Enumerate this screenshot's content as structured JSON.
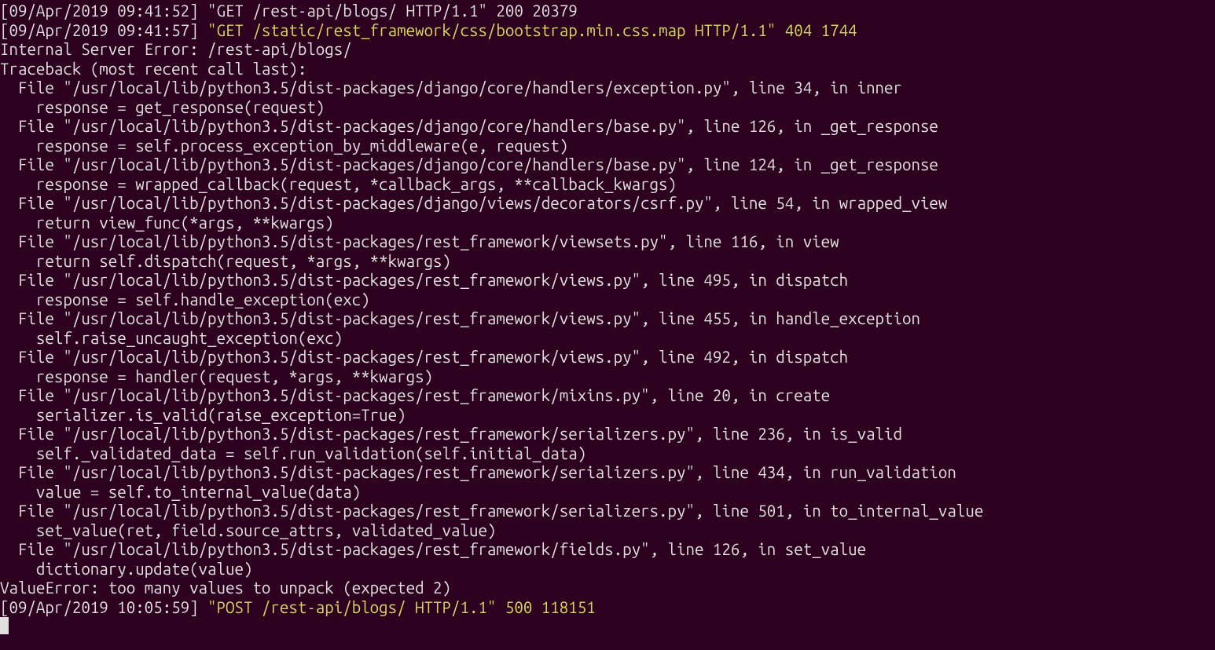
{
  "terminal": {
    "lines": [
      {
        "segments": [
          {
            "cls": "grey",
            "text": "[09/Apr/2019 09:41:52] "
          },
          {
            "cls": "grey",
            "text": "\"GET /rest-api/blogs/ HTTP/1.1\" 200 20379"
          }
        ]
      },
      {
        "segments": [
          {
            "cls": "grey",
            "text": "[09/Apr/2019 09:41:57] "
          },
          {
            "cls": "yellow",
            "text": "\"GET /static/rest_framework/css/bootstrap.min.css.map HTTP/1.1\" 404 1744"
          }
        ]
      },
      {
        "segments": [
          {
            "cls": "grey",
            "text": "Internal Server Error: /rest-api/blogs/"
          }
        ]
      },
      {
        "segments": [
          {
            "cls": "grey",
            "text": "Traceback (most recent call last):"
          }
        ]
      },
      {
        "segments": [
          {
            "cls": "grey",
            "text": "  File \"/usr/local/lib/python3.5/dist-packages/django/core/handlers/exception.py\", line 34, in inner"
          }
        ]
      },
      {
        "segments": [
          {
            "cls": "grey",
            "text": "    response = get_response(request)"
          }
        ]
      },
      {
        "segments": [
          {
            "cls": "grey",
            "text": "  File \"/usr/local/lib/python3.5/dist-packages/django/core/handlers/base.py\", line 126, in _get_response"
          }
        ]
      },
      {
        "segments": [
          {
            "cls": "grey",
            "text": "    response = self.process_exception_by_middleware(e, request)"
          }
        ]
      },
      {
        "segments": [
          {
            "cls": "grey",
            "text": "  File \"/usr/local/lib/python3.5/dist-packages/django/core/handlers/base.py\", line 124, in _get_response"
          }
        ]
      },
      {
        "segments": [
          {
            "cls": "grey",
            "text": "    response = wrapped_callback(request, *callback_args, **callback_kwargs)"
          }
        ]
      },
      {
        "segments": [
          {
            "cls": "grey",
            "text": "  File \"/usr/local/lib/python3.5/dist-packages/django/views/decorators/csrf.py\", line 54, in wrapped_view"
          }
        ]
      },
      {
        "segments": [
          {
            "cls": "grey",
            "text": "    return view_func(*args, **kwargs)"
          }
        ]
      },
      {
        "segments": [
          {
            "cls": "grey",
            "text": "  File \"/usr/local/lib/python3.5/dist-packages/rest_framework/viewsets.py\", line 116, in view"
          }
        ]
      },
      {
        "segments": [
          {
            "cls": "grey",
            "text": "    return self.dispatch(request, *args, **kwargs)"
          }
        ]
      },
      {
        "segments": [
          {
            "cls": "grey",
            "text": "  File \"/usr/local/lib/python3.5/dist-packages/rest_framework/views.py\", line 495, in dispatch"
          }
        ]
      },
      {
        "segments": [
          {
            "cls": "grey",
            "text": "    response = self.handle_exception(exc)"
          }
        ]
      },
      {
        "segments": [
          {
            "cls": "grey",
            "text": "  File \"/usr/local/lib/python3.5/dist-packages/rest_framework/views.py\", line 455, in handle_exception"
          }
        ]
      },
      {
        "segments": [
          {
            "cls": "grey",
            "text": "    self.raise_uncaught_exception(exc)"
          }
        ]
      },
      {
        "segments": [
          {
            "cls": "grey",
            "text": "  File \"/usr/local/lib/python3.5/dist-packages/rest_framework/views.py\", line 492, in dispatch"
          }
        ]
      },
      {
        "segments": [
          {
            "cls": "grey",
            "text": "    response = handler(request, *args, **kwargs)"
          }
        ]
      },
      {
        "segments": [
          {
            "cls": "grey",
            "text": "  File \"/usr/local/lib/python3.5/dist-packages/rest_framework/mixins.py\", line 20, in create"
          }
        ]
      },
      {
        "segments": [
          {
            "cls": "grey",
            "text": "    serializer.is_valid(raise_exception=True)"
          }
        ]
      },
      {
        "segments": [
          {
            "cls": "grey",
            "text": "  File \"/usr/local/lib/python3.5/dist-packages/rest_framework/serializers.py\", line 236, in is_valid"
          }
        ]
      },
      {
        "segments": [
          {
            "cls": "grey",
            "text": "    self._validated_data = self.run_validation(self.initial_data)"
          }
        ]
      },
      {
        "segments": [
          {
            "cls": "grey",
            "text": "  File \"/usr/local/lib/python3.5/dist-packages/rest_framework/serializers.py\", line 434, in run_validation"
          }
        ]
      },
      {
        "segments": [
          {
            "cls": "grey",
            "text": "    value = self.to_internal_value(data)"
          }
        ]
      },
      {
        "segments": [
          {
            "cls": "grey",
            "text": "  File \"/usr/local/lib/python3.5/dist-packages/rest_framework/serializers.py\", line 501, in to_internal_value"
          }
        ]
      },
      {
        "segments": [
          {
            "cls": "grey",
            "text": "    set_value(ret, field.source_attrs, validated_value)"
          }
        ]
      },
      {
        "segments": [
          {
            "cls": "grey",
            "text": "  File \"/usr/local/lib/python3.5/dist-packages/rest_framework/fields.py\", line 126, in set_value"
          }
        ]
      },
      {
        "segments": [
          {
            "cls": "grey",
            "text": "    dictionary.update(value)"
          }
        ]
      },
      {
        "segments": [
          {
            "cls": "grey",
            "text": "ValueError: too many values to unpack (expected 2)"
          }
        ]
      },
      {
        "segments": [
          {
            "cls": "grey",
            "text": "[09/Apr/2019 10:05:59] "
          },
          {
            "cls": "yellow",
            "text": "\"POST /rest-api/blogs/ HTTP/1.1\" 500 118151"
          }
        ]
      }
    ]
  }
}
